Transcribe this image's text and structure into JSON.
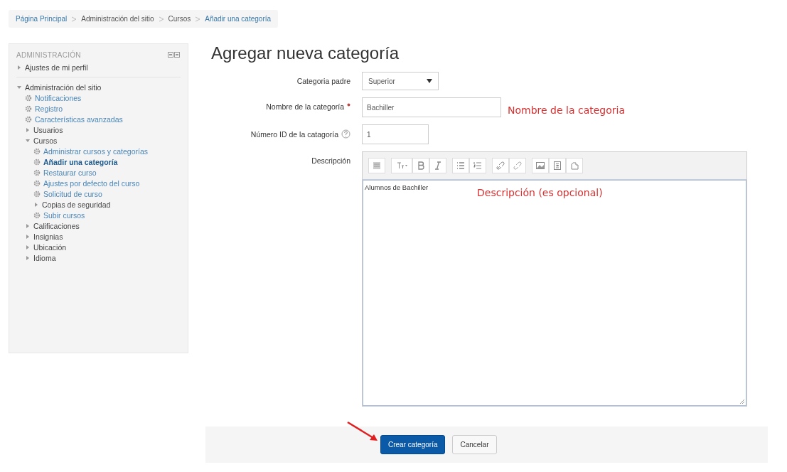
{
  "breadcrumb": [
    {
      "label": "Página Principal",
      "link": true
    },
    {
      "label": "Administración del sitio",
      "link": false
    },
    {
      "label": "Cursos",
      "link": false
    },
    {
      "label": "Añadir una categoría",
      "link": true
    }
  ],
  "sidebar": {
    "title": "ADMINISTRACIÓN",
    "items": [
      {
        "label": "Ajustes de mi perfil",
        "kind": "folder",
        "expanded": false
      },
      {
        "label": "Administración del sitio",
        "kind": "folder",
        "expanded": true,
        "children": [
          {
            "label": "Notificaciones",
            "kind": "link",
            "selected": false
          },
          {
            "label": "Registro",
            "kind": "link",
            "selected": false
          },
          {
            "label": "Características avanzadas",
            "kind": "link",
            "selected": false
          },
          {
            "label": "Usuarios",
            "kind": "folder",
            "expanded": false
          },
          {
            "label": "Cursos",
            "kind": "folder",
            "expanded": true,
            "children": [
              {
                "label": "Administrar cursos y categorías",
                "kind": "link",
                "selected": false
              },
              {
                "label": "Añadir una categoría",
                "kind": "link",
                "selected": true
              },
              {
                "label": "Restaurar curso",
                "kind": "link",
                "selected": false
              },
              {
                "label": "Ajustes por defecto del curso",
                "kind": "link",
                "selected": false
              },
              {
                "label": "Solicitud de curso",
                "kind": "link",
                "selected": false
              },
              {
                "label": "Copias de seguridad",
                "kind": "folder",
                "expanded": false
              },
              {
                "label": "Subir cursos",
                "kind": "link",
                "selected": false
              }
            ]
          },
          {
            "label": "Calificaciones",
            "kind": "folder",
            "expanded": false
          },
          {
            "label": "Insignias",
            "kind": "folder",
            "expanded": false
          },
          {
            "label": "Ubicación",
            "kind": "folder",
            "expanded": false
          },
          {
            "label": "Idioma",
            "kind": "folder",
            "expanded": false
          }
        ]
      }
    ]
  },
  "heading": "Agregar nueva categoría",
  "form": {
    "parent": {
      "label": "Categoria padre",
      "value": "Superior"
    },
    "name": {
      "label": "Nombre de la categoría",
      "value": "Bachiller",
      "note": "Nombre de la categoria"
    },
    "idnumber": {
      "label": "Número ID de la catagoría",
      "value": "1"
    },
    "description": {
      "label": "Descripción",
      "value": "Alumnos de Bachiller",
      "note": "Descripción (es opcional)"
    }
  },
  "buttons": [
    {
      "label": "Crear categoría",
      "primary": true
    },
    {
      "label": "Cancelar",
      "primary": false
    }
  ]
}
